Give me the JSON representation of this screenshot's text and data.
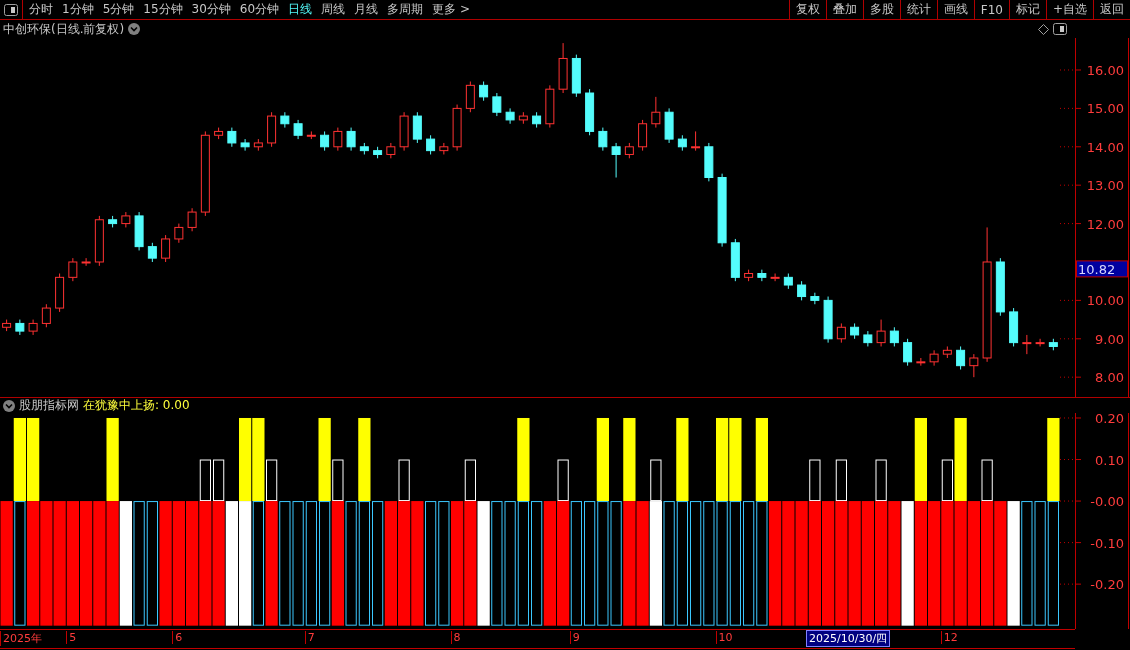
{
  "toolbar": {
    "tabs": [
      {
        "label": "分时",
        "selected": false
      },
      {
        "label": "1分钟",
        "selected": false
      },
      {
        "label": "5分钟",
        "selected": false
      },
      {
        "label": "15分钟",
        "selected": false
      },
      {
        "label": "30分钟",
        "selected": false
      },
      {
        "label": "60分钟",
        "selected": false
      },
      {
        "label": "日线",
        "selected": true
      },
      {
        "label": "周线",
        "selected": false
      },
      {
        "label": "月线",
        "selected": false
      },
      {
        "label": "多周期",
        "selected": false
      },
      {
        "label": "更多 >",
        "selected": false
      }
    ],
    "buttons": [
      "复权",
      "叠加",
      "多股",
      "统计",
      "画线",
      "F10",
      "标记",
      "+自选",
      "返回"
    ]
  },
  "title": "中创环保(日线.前复权)",
  "price_chart": {
    "last_price_tag": "10.82",
    "chart_data": {
      "type": "candlestick",
      "ylim": [
        7.484,
        16.833
      ],
      "yticks": [
        {
          "value": 8,
          "label": "8.00"
        },
        {
          "value": 9,
          "label": "9.00"
        },
        {
          "value": 10,
          "label": "10.00"
        },
        {
          "value": 12,
          "label": "12.00"
        },
        {
          "value": 13,
          "label": "13.00"
        },
        {
          "value": 14,
          "label": "14.00"
        },
        {
          "value": 15,
          "label": "15.00"
        },
        {
          "value": 16,
          "label": "16.00"
        }
      ],
      "categories": [
        null,
        null,
        null,
        null,
        null,
        null,
        null,
        null,
        null,
        null,
        null,
        null,
        null,
        null,
        null,
        null,
        null,
        null,
        null,
        null,
        null,
        null,
        null,
        null,
        null,
        null,
        null,
        null,
        null,
        null,
        null,
        null,
        null,
        null,
        null,
        null,
        null,
        null,
        null,
        null,
        null,
        null,
        null,
        null,
        null,
        null,
        null,
        null,
        null,
        null,
        null,
        null,
        null,
        null,
        null,
        null,
        null,
        null,
        null,
        null,
        null,
        null,
        null,
        null,
        null,
        null,
        null,
        null,
        null,
        null,
        null,
        null,
        null,
        null,
        null,
        null,
        null,
        null,
        null,
        null
      ],
      "ohlc": [
        [
          9.3,
          9.5,
          9.2,
          9.4
        ],
        [
          9.4,
          9.5,
          9.1,
          9.2
        ],
        [
          9.2,
          9.5,
          9.1,
          9.4
        ],
        [
          9.4,
          9.9,
          9.3,
          9.8
        ],
        [
          9.8,
          10.7,
          9.7,
          10.6
        ],
        [
          10.6,
          11.1,
          10.5,
          11.0
        ],
        [
          11.0,
          11.1,
          10.9,
          11.0
        ],
        [
          11.0,
          12.2,
          10.9,
          12.1
        ],
        [
          12.1,
          12.2,
          11.9,
          12.0
        ],
        [
          12.0,
          12.3,
          11.9,
          12.2
        ],
        [
          12.2,
          12.3,
          11.3,
          11.4
        ],
        [
          11.4,
          11.5,
          11.0,
          11.1
        ],
        [
          11.1,
          11.7,
          11.0,
          11.6
        ],
        [
          11.6,
          12.0,
          11.5,
          11.9
        ],
        [
          11.9,
          12.4,
          11.8,
          12.3
        ],
        [
          12.3,
          14.4,
          12.2,
          14.3
        ],
        [
          14.3,
          14.5,
          14.2,
          14.4
        ],
        [
          14.4,
          14.5,
          14.0,
          14.1
        ],
        [
          14.1,
          14.2,
          13.9,
          14.0
        ],
        [
          14.0,
          14.2,
          13.9,
          14.1
        ],
        [
          14.1,
          14.9,
          14.0,
          14.8
        ],
        [
          14.8,
          14.9,
          14.5,
          14.6
        ],
        [
          14.6,
          14.7,
          14.2,
          14.3
        ],
        [
          14.3,
          14.4,
          14.2,
          14.3
        ],
        [
          14.3,
          14.4,
          13.9,
          14.0
        ],
        [
          14.0,
          14.5,
          13.9,
          14.4
        ],
        [
          14.4,
          14.5,
          13.9,
          14.0
        ],
        [
          14.0,
          14.1,
          13.8,
          13.9
        ],
        [
          13.9,
          14.0,
          13.7,
          13.8
        ],
        [
          13.8,
          14.1,
          13.7,
          14.0
        ],
        [
          14.0,
          14.9,
          13.9,
          14.8
        ],
        [
          14.8,
          14.9,
          14.1,
          14.2
        ],
        [
          14.2,
          14.3,
          13.8,
          13.9
        ],
        [
          13.9,
          14.1,
          13.8,
          14.0
        ],
        [
          14.0,
          15.1,
          13.9,
          15.0
        ],
        [
          15.0,
          15.7,
          14.9,
          15.6
        ],
        [
          15.6,
          15.7,
          15.2,
          15.3
        ],
        [
          15.3,
          15.4,
          14.8,
          14.9
        ],
        [
          14.9,
          15.0,
          14.6,
          14.7
        ],
        [
          14.7,
          14.9,
          14.6,
          14.8
        ],
        [
          14.8,
          14.9,
          14.5,
          14.6
        ],
        [
          14.6,
          15.6,
          14.5,
          15.5
        ],
        [
          15.5,
          16.7,
          15.4,
          16.3
        ],
        [
          16.3,
          16.4,
          15.3,
          15.4
        ],
        [
          15.4,
          15.5,
          14.3,
          14.4
        ],
        [
          14.4,
          14.5,
          13.9,
          14.0
        ],
        [
          14.0,
          14.1,
          13.2,
          13.8
        ],
        [
          13.8,
          14.1,
          13.7,
          14.0
        ],
        [
          14.0,
          14.7,
          13.9,
          14.6
        ],
        [
          14.6,
          15.3,
          14.5,
          14.9
        ],
        [
          14.9,
          15.0,
          14.1,
          14.2
        ],
        [
          14.2,
          14.3,
          13.9,
          14.0
        ],
        [
          14.0,
          14.4,
          13.9,
          14.0
        ],
        [
          14.0,
          14.1,
          13.1,
          13.2
        ],
        [
          13.2,
          13.3,
          11.4,
          11.5
        ],
        [
          11.5,
          11.6,
          10.5,
          10.6
        ],
        [
          10.6,
          10.8,
          10.5,
          10.7
        ],
        [
          10.7,
          10.8,
          10.5,
          10.6
        ],
        [
          10.6,
          10.7,
          10.5,
          10.6
        ],
        [
          10.6,
          10.7,
          10.3,
          10.4
        ],
        [
          10.4,
          10.5,
          10.0,
          10.1
        ],
        [
          10.1,
          10.2,
          9.9,
          10.0
        ],
        [
          10.0,
          10.1,
          8.9,
          9.0
        ],
        [
          9.0,
          9.4,
          8.9,
          9.3
        ],
        [
          9.3,
          9.4,
          9.0,
          9.1
        ],
        [
          9.1,
          9.2,
          8.8,
          8.9
        ],
        [
          8.9,
          9.5,
          8.8,
          9.2
        ],
        [
          9.2,
          9.3,
          8.8,
          8.9
        ],
        [
          8.9,
          9.0,
          8.3,
          8.4
        ],
        [
          8.4,
          8.5,
          8.3,
          8.4
        ],
        [
          8.4,
          8.7,
          8.3,
          8.6
        ],
        [
          8.6,
          8.8,
          8.5,
          8.7
        ],
        [
          8.7,
          8.8,
          8.2,
          8.3
        ],
        [
          8.3,
          8.6,
          8.0,
          8.5
        ],
        [
          8.5,
          11.9,
          8.4,
          11.0
        ],
        [
          11.0,
          11.1,
          9.6,
          9.7
        ],
        [
          9.7,
          9.8,
          8.8,
          8.9
        ],
        [
          8.9,
          9.1,
          8.6,
          8.9
        ],
        [
          8.9,
          9.0,
          8.8,
          8.9
        ],
        [
          8.9,
          9.0,
          8.7,
          8.8
        ]
      ]
    }
  },
  "indicator": {
    "name": "股朋指标网",
    "reading": "在犹豫中上扬: 0.00",
    "series_outlined": [
      false,
      true,
      false,
      false,
      true
    ],
    "crosshair_date": "2025/10/30/四",
    "axis_year": "2025年",
    "chart_data": {
      "type": "bar",
      "ylim": [
        -0.308,
        0.212
      ],
      "categories": [
        null,
        null,
        null,
        null,
        null,
        "5",
        null,
        null,
        null,
        null,
        null,
        null,
        null,
        "6",
        null,
        null,
        null,
        null,
        null,
        null,
        null,
        null,
        null,
        "7",
        null,
        null,
        null,
        null,
        null,
        null,
        null,
        null,
        null,
        null,
        "8",
        null,
        null,
        null,
        null,
        null,
        null,
        null,
        null,
        "9",
        null,
        null,
        null,
        null,
        null,
        null,
        null,
        null,
        null,
        null,
        "10",
        null,
        null,
        null,
        null,
        null,
        null,
        null,
        null,
        null,
        null,
        null,
        null,
        null,
        null,
        null,
        null,
        "12",
        null,
        null,
        null,
        null,
        null,
        null,
        null,
        null
      ],
      "yticks": [
        {
          "value": 0.2,
          "label": "0.20"
        },
        {
          "value": 0.1,
          "label": "0.10"
        },
        {
          "value": 0,
          "label": "-0.00"
        },
        {
          "value": -0.1,
          "label": "-0.10"
        },
        {
          "value": -0.2,
          "label": "-0.20"
        }
      ],
      "series": [
        {
          "color": "#ffff00",
          "values": [
            null,
            0.2,
            0.2,
            null,
            null,
            null,
            null,
            null,
            0.2,
            null,
            null,
            null,
            null,
            null,
            null,
            null,
            null,
            null,
            0.2,
            0.2,
            null,
            null,
            null,
            null,
            0.2,
            null,
            null,
            0.2,
            null,
            null,
            null,
            null,
            null,
            null,
            null,
            null,
            null,
            null,
            null,
            0.2,
            null,
            null,
            null,
            null,
            null,
            0.2,
            null,
            0.2,
            null,
            null,
            null,
            0.2,
            null,
            null,
            0.2,
            0.2,
            null,
            0.2,
            null,
            null,
            null,
            null,
            null,
            null,
            null,
            null,
            null,
            null,
            null,
            0.2,
            null,
            null,
            0.2,
            null,
            null,
            null,
            null,
            null,
            null,
            0.2
          ]
        },
        {
          "color": "#ffffff",
          "values": [
            null,
            null,
            null,
            null,
            null,
            null,
            null,
            null,
            null,
            null,
            null,
            null,
            null,
            null,
            null,
            0.1,
            0.1,
            null,
            null,
            null,
            0.1,
            null,
            null,
            null,
            null,
            0.1,
            null,
            null,
            null,
            null,
            0.1,
            null,
            null,
            null,
            null,
            0.1,
            null,
            null,
            null,
            null,
            null,
            null,
            0.1,
            null,
            null,
            null,
            null,
            null,
            null,
            0.1,
            null,
            null,
            null,
            null,
            null,
            null,
            null,
            null,
            null,
            null,
            null,
            0.1,
            null,
            0.1,
            null,
            null,
            0.1,
            null,
            null,
            null,
            null,
            0.1,
            null,
            null,
            0.1,
            null,
            null,
            null,
            null,
            null
          ]
        },
        {
          "color": "#ff0000",
          "values": [
            -0.3,
            null,
            -0.3,
            -0.3,
            -0.3,
            -0.3,
            -0.3,
            -0.3,
            -0.3,
            null,
            null,
            null,
            -0.3,
            -0.3,
            -0.3,
            -0.3,
            -0.3,
            null,
            null,
            null,
            -0.3,
            null,
            null,
            null,
            null,
            -0.3,
            null,
            null,
            null,
            -0.3,
            -0.3,
            -0.3,
            null,
            null,
            -0.3,
            -0.3,
            null,
            null,
            null,
            null,
            null,
            -0.3,
            -0.3,
            null,
            null,
            null,
            null,
            -0.3,
            -0.3,
            null,
            null,
            null,
            null,
            null,
            null,
            null,
            null,
            null,
            -0.3,
            -0.3,
            -0.3,
            -0.3,
            -0.3,
            -0.3,
            -0.3,
            -0.3,
            -0.3,
            -0.3,
            null,
            -0.3,
            -0.3,
            -0.3,
            -0.3,
            -0.3,
            -0.3,
            -0.3,
            null,
            null,
            null,
            null
          ]
        },
        {
          "color": "#ffffff",
          "values": [
            null,
            null,
            null,
            null,
            null,
            null,
            null,
            null,
            null,
            -0.3,
            null,
            null,
            null,
            null,
            null,
            null,
            null,
            -0.3,
            -0.3,
            null,
            null,
            null,
            null,
            null,
            null,
            null,
            null,
            null,
            null,
            null,
            null,
            null,
            null,
            null,
            null,
            null,
            -0.3,
            null,
            null,
            null,
            null,
            null,
            null,
            null,
            null,
            null,
            null,
            null,
            null,
            -0.3,
            null,
            null,
            null,
            null,
            null,
            null,
            null,
            null,
            null,
            null,
            null,
            null,
            null,
            null,
            null,
            null,
            null,
            null,
            -0.3,
            null,
            null,
            null,
            null,
            null,
            null,
            null,
            -0.3,
            null,
            null,
            null
          ]
        },
        {
          "color": "#3cc8ff",
          "values": [
            null,
            -0.3,
            null,
            null,
            null,
            null,
            null,
            null,
            null,
            null,
            -0.3,
            -0.3,
            null,
            null,
            null,
            null,
            null,
            null,
            null,
            -0.3,
            null,
            -0.3,
            -0.3,
            -0.3,
            -0.3,
            null,
            -0.3,
            -0.3,
            -0.3,
            null,
            null,
            null,
            -0.3,
            -0.3,
            null,
            null,
            null,
            -0.3,
            -0.3,
            -0.3,
            -0.3,
            null,
            null,
            -0.3,
            -0.3,
            -0.3,
            -0.3,
            null,
            null,
            null,
            -0.3,
            -0.3,
            -0.3,
            -0.3,
            -0.3,
            -0.3,
            -0.3,
            -0.3,
            null,
            null,
            null,
            null,
            null,
            null,
            null,
            null,
            null,
            null,
            null,
            null,
            null,
            null,
            null,
            null,
            null,
            null,
            null,
            -0.3,
            -0.3,
            -0.3
          ]
        }
      ]
    }
  }
}
